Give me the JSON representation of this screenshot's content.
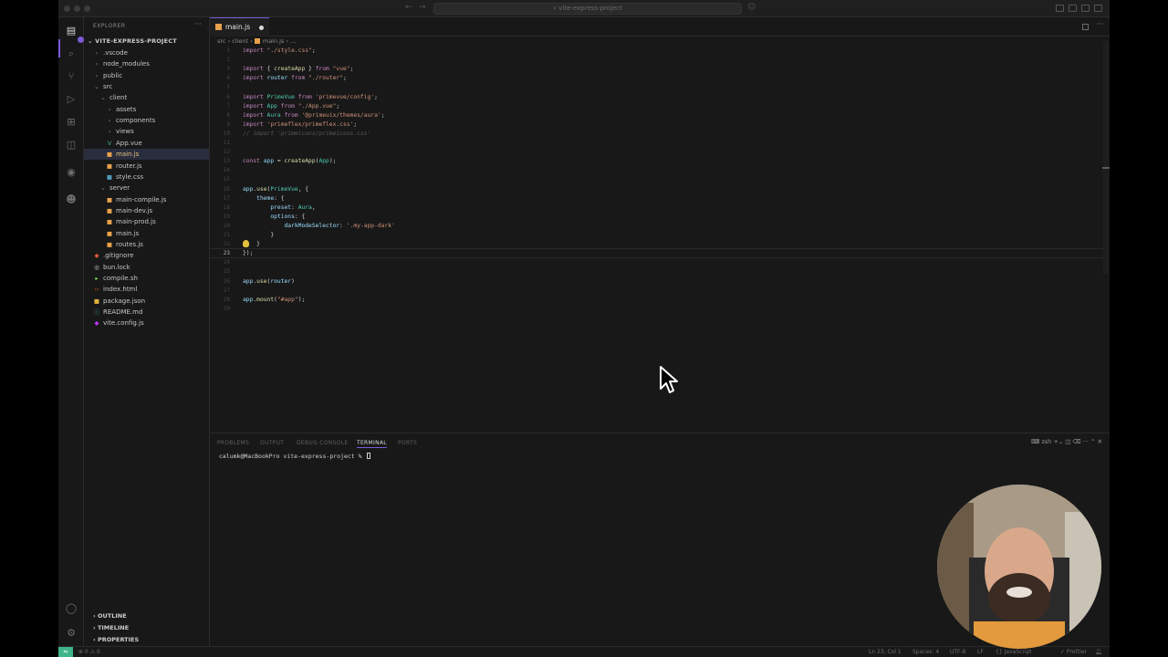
{
  "window": {
    "title": "vite-express-project"
  },
  "sidebar": {
    "header": "EXPLORER",
    "more": "···",
    "root": "VITE-EXPRESS-PROJECT",
    "items": [
      {
        "label": ".vscode",
        "icon": "folder-icon",
        "depth": 0
      },
      {
        "label": "node_modules",
        "icon": "folder-icon",
        "depth": 0
      },
      {
        "label": "public",
        "icon": "folder-icon",
        "depth": 0
      },
      {
        "label": "src",
        "icon": "folder-open-icon",
        "depth": 0
      },
      {
        "label": "client",
        "icon": "folder-open-icon",
        "depth": 1
      },
      {
        "label": "assets",
        "icon": "folder-icon",
        "depth": 2
      },
      {
        "label": "components",
        "icon": "folder-icon",
        "depth": 2
      },
      {
        "label": "views",
        "icon": "folder-icon",
        "depth": 2
      },
      {
        "label": "App.vue",
        "icon": "vue-file-icon",
        "depth": 2
      },
      {
        "label": "main.js",
        "icon": "js-file-icon",
        "depth": 2,
        "selected": true
      },
      {
        "label": "router.js",
        "icon": "js-file-icon",
        "depth": 2
      },
      {
        "label": "style.css",
        "icon": "css-file-icon",
        "depth": 2
      },
      {
        "label": "server",
        "icon": "folder-open-icon",
        "depth": 1
      },
      {
        "label": "main-compile.js",
        "icon": "js-file-icon",
        "depth": 2
      },
      {
        "label": "main-dev.js",
        "icon": "js-file-icon",
        "depth": 2
      },
      {
        "label": "main-prod.js",
        "icon": "js-file-icon",
        "depth": 2
      },
      {
        "label": "main.js",
        "icon": "js-file-icon",
        "depth": 2
      },
      {
        "label": "routes.js",
        "icon": "js-file-icon",
        "depth": 2
      },
      {
        "label": ".gitignore",
        "icon": "git-icon",
        "depth": 0
      },
      {
        "label": "bun.lock",
        "icon": "lock-file-icon",
        "depth": 0
      },
      {
        "label": "compile.sh",
        "icon": "shell-file-icon",
        "depth": 0
      },
      {
        "label": "index.html",
        "icon": "html-file-icon",
        "depth": 0
      },
      {
        "label": "package.json",
        "icon": "json-file-icon",
        "depth": 0
      },
      {
        "label": "README.md",
        "icon": "markdown-file-icon",
        "depth": 0
      },
      {
        "label": "vite.config.js",
        "icon": "vite-file-icon",
        "depth": 0
      }
    ],
    "sections": [
      "OUTLINE",
      "TIMELINE",
      "PROPERTIES"
    ]
  },
  "editor": {
    "tab_label": "main.js",
    "breadcrumb": [
      "src",
      "client",
      "main.js",
      "..."
    ],
    "active_line": 23,
    "lines": [
      [
        [
          "kw",
          "import "
        ],
        [
          "str",
          "\"./style.css\""
        ],
        [
          "p",
          ";"
        ]
      ],
      [],
      [
        [
          "kw",
          "import "
        ],
        [
          "p",
          "{ "
        ],
        [
          "fn",
          "createApp"
        ],
        [
          "p",
          " } "
        ],
        [
          "kw",
          "from "
        ],
        [
          "str",
          "\"vue\""
        ],
        [
          "p",
          ";"
        ]
      ],
      [
        [
          "kw",
          "import "
        ],
        [
          "var",
          "router "
        ],
        [
          "kw",
          "from "
        ],
        [
          "str",
          "\"./router\""
        ],
        [
          "p",
          ";"
        ]
      ],
      [],
      [
        [
          "kw",
          "import "
        ],
        [
          "cls",
          "PrimeVue "
        ],
        [
          "kw",
          "from "
        ],
        [
          "str",
          "'primevue/config'"
        ],
        [
          "p",
          ";"
        ]
      ],
      [
        [
          "kw",
          "import "
        ],
        [
          "cls",
          "App "
        ],
        [
          "kw",
          "from "
        ],
        [
          "str",
          "\"./App.vue\""
        ],
        [
          "p",
          ";"
        ]
      ],
      [
        [
          "kw",
          "import "
        ],
        [
          "cls",
          "Aura "
        ],
        [
          "kw",
          "from "
        ],
        [
          "str",
          "'@primeuix/themes/aura'"
        ],
        [
          "p",
          ";"
        ]
      ],
      [
        [
          "kw",
          "import "
        ],
        [
          "str",
          "'primeflex/primeflex.css'"
        ],
        [
          "p",
          ";"
        ]
      ],
      [
        [
          "cm",
          "// import 'primeicons/primeicons.css'"
        ]
      ],
      [],
      [],
      [
        [
          "kw",
          "const "
        ],
        [
          "var",
          "app "
        ],
        [
          "p",
          "= "
        ],
        [
          "fn",
          "createApp"
        ],
        [
          "p",
          "("
        ],
        [
          "cls",
          "App"
        ],
        [
          "p",
          ");"
        ]
      ],
      [],
      [],
      [
        [
          "var",
          "app"
        ],
        [
          "p",
          "."
        ],
        [
          "fn",
          "use"
        ],
        [
          "p",
          "("
        ],
        [
          "cls",
          "PrimeVue"
        ],
        [
          "p",
          ", {"
        ]
      ],
      [
        [
          "p",
          "    "
        ],
        [
          "pr",
          "theme"
        ],
        [
          "p",
          ": {"
        ]
      ],
      [
        [
          "p",
          "        "
        ],
        [
          "pr",
          "preset"
        ],
        [
          "p",
          ": "
        ],
        [
          "cls",
          "Aura"
        ],
        [
          "p",
          ","
        ]
      ],
      [
        [
          "p",
          "        "
        ],
        [
          "pr",
          "options"
        ],
        [
          "p",
          ": {"
        ]
      ],
      [
        [
          "p",
          "            "
        ],
        [
          "pr",
          "darkModeSelector"
        ],
        [
          "p",
          ": "
        ],
        [
          "str",
          "'.my-app-dark'"
        ]
      ],
      [
        [
          "p",
          "        }"
        ]
      ],
      [
        [
          "p",
          "    }"
        ]
      ],
      [
        [
          "p",
          "});"
        ]
      ],
      [],
      [],
      [
        [
          "var",
          "app"
        ],
        [
          "p",
          "."
        ],
        [
          "fn",
          "use"
        ],
        [
          "p",
          "("
        ],
        [
          "var",
          "router"
        ],
        [
          "p",
          ")"
        ]
      ],
      [],
      [
        [
          "var",
          "app"
        ],
        [
          "p",
          "."
        ],
        [
          "fn",
          "mount"
        ],
        [
          "p",
          "("
        ],
        [
          "str",
          "\"#app\""
        ],
        [
          "p",
          ");"
        ]
      ],
      []
    ]
  },
  "panel": {
    "tabs": [
      "PROBLEMS",
      "OUTPUT",
      "DEBUG CONSOLE",
      "TERMINAL",
      "PORTS"
    ],
    "active_tab": "TERMINAL",
    "shell": "zsh",
    "prompt": "calumk@MacBookPro vite-express-project % "
  },
  "statusbar": {
    "left": "⊗ 0 ⚠ 0",
    "position": "Ln 23, Col 1",
    "spaces": "Spaces: 4",
    "encoding": "UTF-8",
    "eol": "LF",
    "language": "{} JavaScript",
    "formatter": "✓ Prettier"
  },
  "colors": {
    "accent": "#7b5cd6",
    "remote": "#3eb489",
    "js_icon": "#e8a24c"
  }
}
